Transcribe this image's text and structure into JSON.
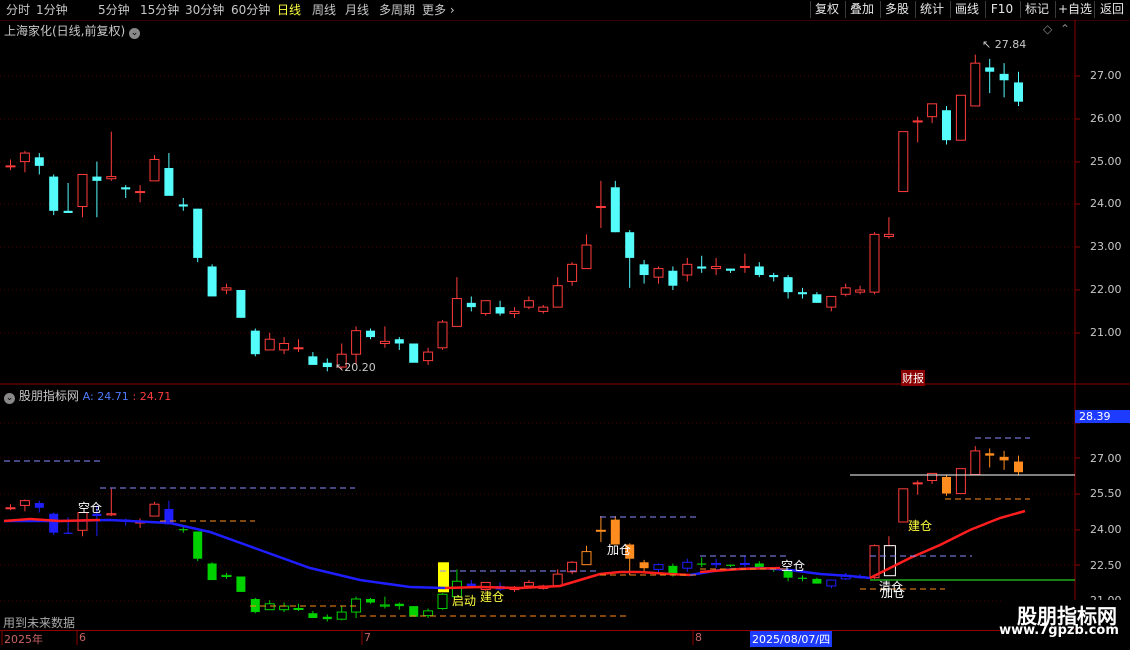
{
  "toolbar": {
    "timeframes": [
      "分时",
      "1分钟",
      "5分钟",
      "15分钟",
      "30分钟",
      "60分钟",
      "日线",
      "周线",
      "月线",
      "多周期",
      "更多"
    ],
    "active_timeframe": "日线",
    "right_buttons": [
      "复权",
      "叠加",
      "多股",
      "统计",
      "画线",
      "F10",
      "标记",
      "+自选",
      "返回"
    ]
  },
  "main_chart": {
    "title": "上海家化(日线,前复权)",
    "price_labels": [
      "27.00",
      "26.00",
      "25.00",
      "24.00",
      "23.00",
      "22.00",
      "21.00"
    ],
    "high_marker": "27.84",
    "low_marker": "20.20",
    "event_tag": "财报"
  },
  "indicator": {
    "title": "股朋指标网",
    "value_a_label": "A: 24.71",
    "value_b_label": ": 24.71",
    "price_labels": [
      "27.00",
      "25.50",
      "24.00",
      "22.50",
      "21.00"
    ],
    "current_price": "28.39",
    "annotations": [
      "空仓",
      "启动",
      "建仓",
      "加仓",
      "空仓",
      "建仓",
      "清仓",
      "加仓"
    ],
    "future_data_note": "用到未来数据"
  },
  "date_axis": {
    "labels": [
      "2025年",
      "6",
      "7",
      "8"
    ],
    "cursor_date": "2025/08/07/四"
  },
  "watermark": {
    "name": "股朋指标网",
    "url": "www.7gpzb.com"
  },
  "colors": {
    "up": "#ff3c3c",
    "down": "#54fcfc",
    "bg": "#000000",
    "ma_blue": "#1e1eff",
    "ma_red": "#ff1e1e",
    "ind_green": "#00d200",
    "ind_orange": "#ff8c1e"
  },
  "chart_data": {
    "type": "candlestick",
    "ohlc": [
      [
        24.9,
        25.05,
        24.8,
        24.9
      ],
      [
        25.0,
        25.25,
        24.75,
        25.2
      ],
      [
        25.1,
        25.2,
        24.7,
        24.9
      ],
      [
        24.65,
        24.7,
        23.75,
        23.85
      ],
      [
        23.85,
        24.5,
        23.8,
        23.8
      ],
      [
        23.95,
        24.6,
        23.7,
        24.7
      ],
      [
        24.65,
        25.0,
        23.7,
        24.55
      ],
      [
        24.6,
        25.7,
        24.55,
        24.65
      ],
      [
        24.4,
        24.45,
        24.15,
        24.35
      ],
      [
        24.3,
        24.45,
        24.05,
        24.3
      ],
      [
        24.55,
        25.15,
        24.6,
        25.05
      ],
      [
        24.85,
        25.2,
        24.25,
        24.2
      ],
      [
        24.0,
        24.15,
        23.85,
        23.95
      ],
      [
        23.9,
        23.9,
        22.65,
        22.75
      ],
      [
        22.55,
        22.6,
        21.85,
        21.85
      ],
      [
        22.0,
        22.15,
        21.9,
        22.05
      ],
      [
        22.0,
        22.0,
        21.35,
        21.35
      ],
      [
        21.05,
        21.1,
        20.45,
        20.5
      ],
      [
        20.6,
        21.0,
        20.6,
        20.85
      ],
      [
        20.6,
        20.9,
        20.5,
        20.75
      ],
      [
        20.65,
        20.85,
        20.55,
        20.65
      ],
      [
        20.45,
        20.55,
        20.25,
        20.25
      ],
      [
        20.3,
        20.4,
        20.1,
        20.2
      ],
      [
        20.2,
        20.75,
        20.15,
        20.5
      ],
      [
        20.5,
        21.15,
        20.25,
        21.05
      ],
      [
        21.05,
        21.1,
        20.85,
        20.9
      ],
      [
        20.75,
        21.15,
        20.65,
        20.8
      ],
      [
        20.85,
        20.9,
        20.6,
        20.75
      ],
      [
        20.75,
        20.75,
        20.35,
        20.3
      ],
      [
        20.35,
        20.65,
        20.25,
        20.55
      ],
      [
        20.65,
        21.3,
        20.6,
        21.25
      ],
      [
        21.15,
        22.3,
        21.15,
        21.8
      ],
      [
        21.7,
        21.85,
        21.5,
        21.6
      ],
      [
        21.45,
        21.75,
        21.4,
        21.75
      ],
      [
        21.6,
        21.75,
        21.4,
        21.45
      ],
      [
        21.45,
        21.6,
        21.35,
        21.5
      ],
      [
        21.6,
        21.85,
        21.55,
        21.75
      ],
      [
        21.5,
        21.65,
        21.45,
        21.6
      ],
      [
        21.6,
        22.3,
        21.6,
        22.1
      ],
      [
        22.2,
        22.65,
        22.1,
        22.6
      ],
      [
        22.5,
        23.3,
        22.5,
        23.05
      ],
      [
        23.95,
        24.55,
        23.45,
        23.95
      ],
      [
        24.4,
        24.55,
        23.35,
        23.35
      ],
      [
        23.35,
        23.4,
        22.05,
        22.75
      ],
      [
        22.6,
        22.7,
        22.15,
        22.35
      ],
      [
        22.3,
        22.55,
        22.15,
        22.5
      ],
      [
        22.45,
        22.55,
        22.0,
        22.1
      ],
      [
        22.35,
        22.75,
        22.2,
        22.6
      ],
      [
        22.55,
        22.8,
        22.4,
        22.5
      ],
      [
        22.5,
        22.75,
        22.35,
        22.55
      ],
      [
        22.5,
        22.5,
        22.4,
        22.45
      ],
      [
        22.55,
        22.85,
        22.4,
        22.55
      ],
      [
        22.55,
        22.65,
        22.3,
        22.35
      ],
      [
        22.35,
        22.4,
        22.2,
        22.3
      ],
      [
        22.3,
        22.35,
        21.8,
        21.95
      ],
      [
        21.95,
        22.05,
        21.8,
        21.9
      ],
      [
        21.9,
        21.95,
        21.7,
        21.7
      ],
      [
        21.6,
        21.85,
        21.5,
        21.85
      ],
      [
        21.9,
        22.15,
        21.85,
        22.05
      ],
      [
        21.95,
        22.1,
        21.9,
        22.0
      ],
      [
        21.95,
        23.35,
        21.9,
        23.3
      ],
      [
        23.25,
        23.7,
        23.2,
        23.3
      ],
      [
        24.3,
        25.7,
        24.3,
        25.7
      ],
      [
        25.95,
        26.05,
        25.45,
        25.95
      ],
      [
        26.05,
        26.35,
        25.9,
        26.35
      ],
      [
        26.2,
        26.3,
        25.4,
        25.5
      ],
      [
        25.5,
        26.5,
        25.5,
        26.55
      ],
      [
        26.3,
        27.5,
        26.3,
        27.3
      ],
      [
        27.2,
        27.4,
        26.6,
        27.1
      ],
      [
        27.05,
        27.3,
        26.5,
        26.9
      ],
      [
        26.85,
        27.1,
        26.3,
        26.4
      ]
    ],
    "price_range": [
      20.2,
      27.84
    ]
  }
}
